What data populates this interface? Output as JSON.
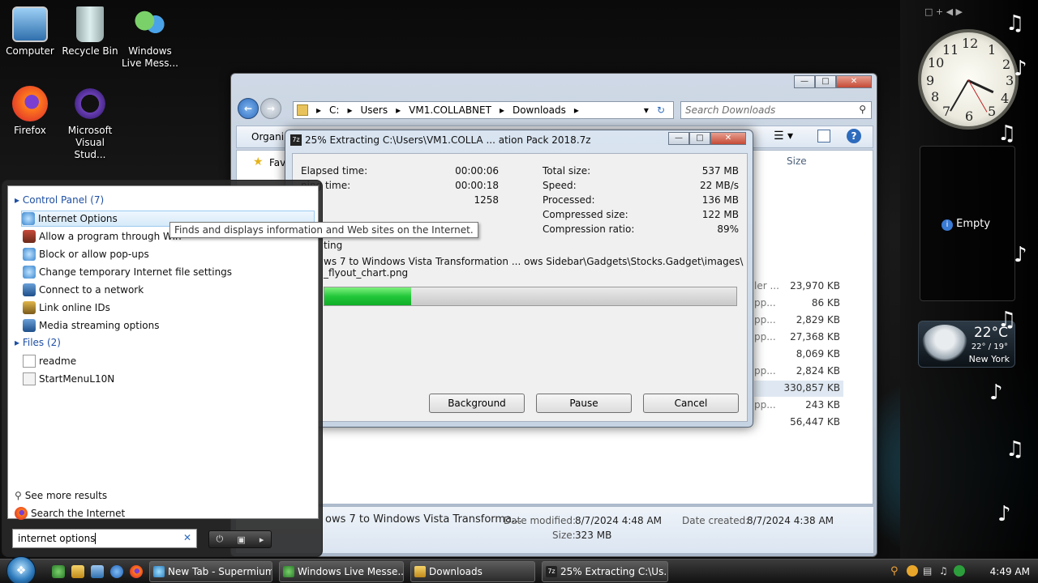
{
  "desktop": {
    "icons": [
      {
        "label": "Computer"
      },
      {
        "label": "Recycle Bin"
      },
      {
        "label": "Windows Live Messenger",
        "label_line1": "Windows",
        "label_line2": "Live Mess..."
      },
      {
        "label": "Firefox"
      },
      {
        "label": "Microsoft Visual Stud...",
        "label_line1": "Microsoft",
        "label_line2": "Visual Stud..."
      }
    ]
  },
  "explorer": {
    "address_parts": [
      "C:",
      "Users",
      "VM1.COLLABNET",
      "Downloads"
    ],
    "search_placeholder": "Search Downloads",
    "organize_label": "Organi",
    "favorites_label": "Fav",
    "size_header": "Size",
    "rows": [
      {
        "type_partial": "ler ...",
        "size": "23,970 KB"
      },
      {
        "type_partial": "pp...",
        "size": "86 KB"
      },
      {
        "type_partial": "pp...",
        "size": "2,829 KB"
      },
      {
        "type_partial": "pp...",
        "size": "27,368 KB"
      },
      {
        "type_partial": "",
        "size": "8,069 KB"
      },
      {
        "type_partial": "pp...",
        "size": "2,824 KB"
      },
      {
        "type_partial": "",
        "size": "330,857 KB"
      },
      {
        "type_partial": "pp...",
        "size": "243 KB"
      },
      {
        "type_partial": "",
        "size": "56,447 KB"
      }
    ],
    "details": {
      "file_name": "ows 7 to Windows Vista Transforma...",
      "date_modified_label": "Date modified:",
      "date_modified": "8/7/2024 4:48 AM",
      "date_created_label": "Date created:",
      "date_created": "8/7/2024 4:38 AM",
      "size_label": "Size:",
      "size": "323 MB"
    }
  },
  "zip_dialog": {
    "title": "25% Extracting C:\\Users\\VM1.COLLA ... ation Pack 2018.7z",
    "logo": "7z",
    "left_stats": [
      {
        "label": "Elapsed time:",
        "value": "00:00:06"
      },
      {
        "label": "ning time:",
        "value": "00:00:18"
      },
      {
        "label": "",
        "value": "1258"
      }
    ],
    "right_stats": [
      {
        "label": "Total size:",
        "value": "537 MB"
      },
      {
        "label": "Speed:",
        "value": "22 MB/s"
      },
      {
        "label": "Processed:",
        "value": "136 MB"
      },
      {
        "label": "Compressed size:",
        "value": "122 MB"
      },
      {
        "label": "Compression ratio:",
        "value": "89%"
      }
    ],
    "status_word": "ting",
    "current_file_line1": "ws 7 to Windows Vista Transformation ... ows Sidebar\\Gadgets\\Stocks.Gadget\\images\\",
    "current_file_line2": "_flyout_chart.png",
    "progress_fraction": 0.21,
    "buttons": {
      "background": "Background",
      "pause": "Pause",
      "cancel": "Cancel"
    }
  },
  "start_menu": {
    "control_panel_header": "Control Panel (7)",
    "control_panel_items": [
      "Internet Options",
      "Allow a program through Win",
      "Block or allow pop-ups",
      "Change temporary Internet file settings",
      "Connect to a network",
      "Link online IDs",
      "Media streaming options"
    ],
    "files_header": "Files (2)",
    "file_items": [
      "readme",
      "StartMenuL10N"
    ],
    "see_more": "See more results",
    "search_internet": "Search the Internet",
    "search_value": "internet options",
    "tooltip": "Finds and displays information and Web sites on the Internet."
  },
  "taskbar": {
    "buttons": [
      {
        "label": "New Tab - Supermium"
      },
      {
        "label": "Windows Live Messe..."
      },
      {
        "label": "Downloads"
      },
      {
        "label": "25% Extracting C:\\Us..."
      }
    ],
    "time": "4:49 AM"
  },
  "sidebar": {
    "clock_numbers": [
      "12",
      "1",
      "2",
      "3",
      "4",
      "5",
      "6",
      "7",
      "8",
      "9",
      "10",
      "11"
    ],
    "empty_label": "Empty",
    "weather": {
      "temp": "22°C",
      "range": "22° / 19°",
      "city": "New York"
    }
  }
}
